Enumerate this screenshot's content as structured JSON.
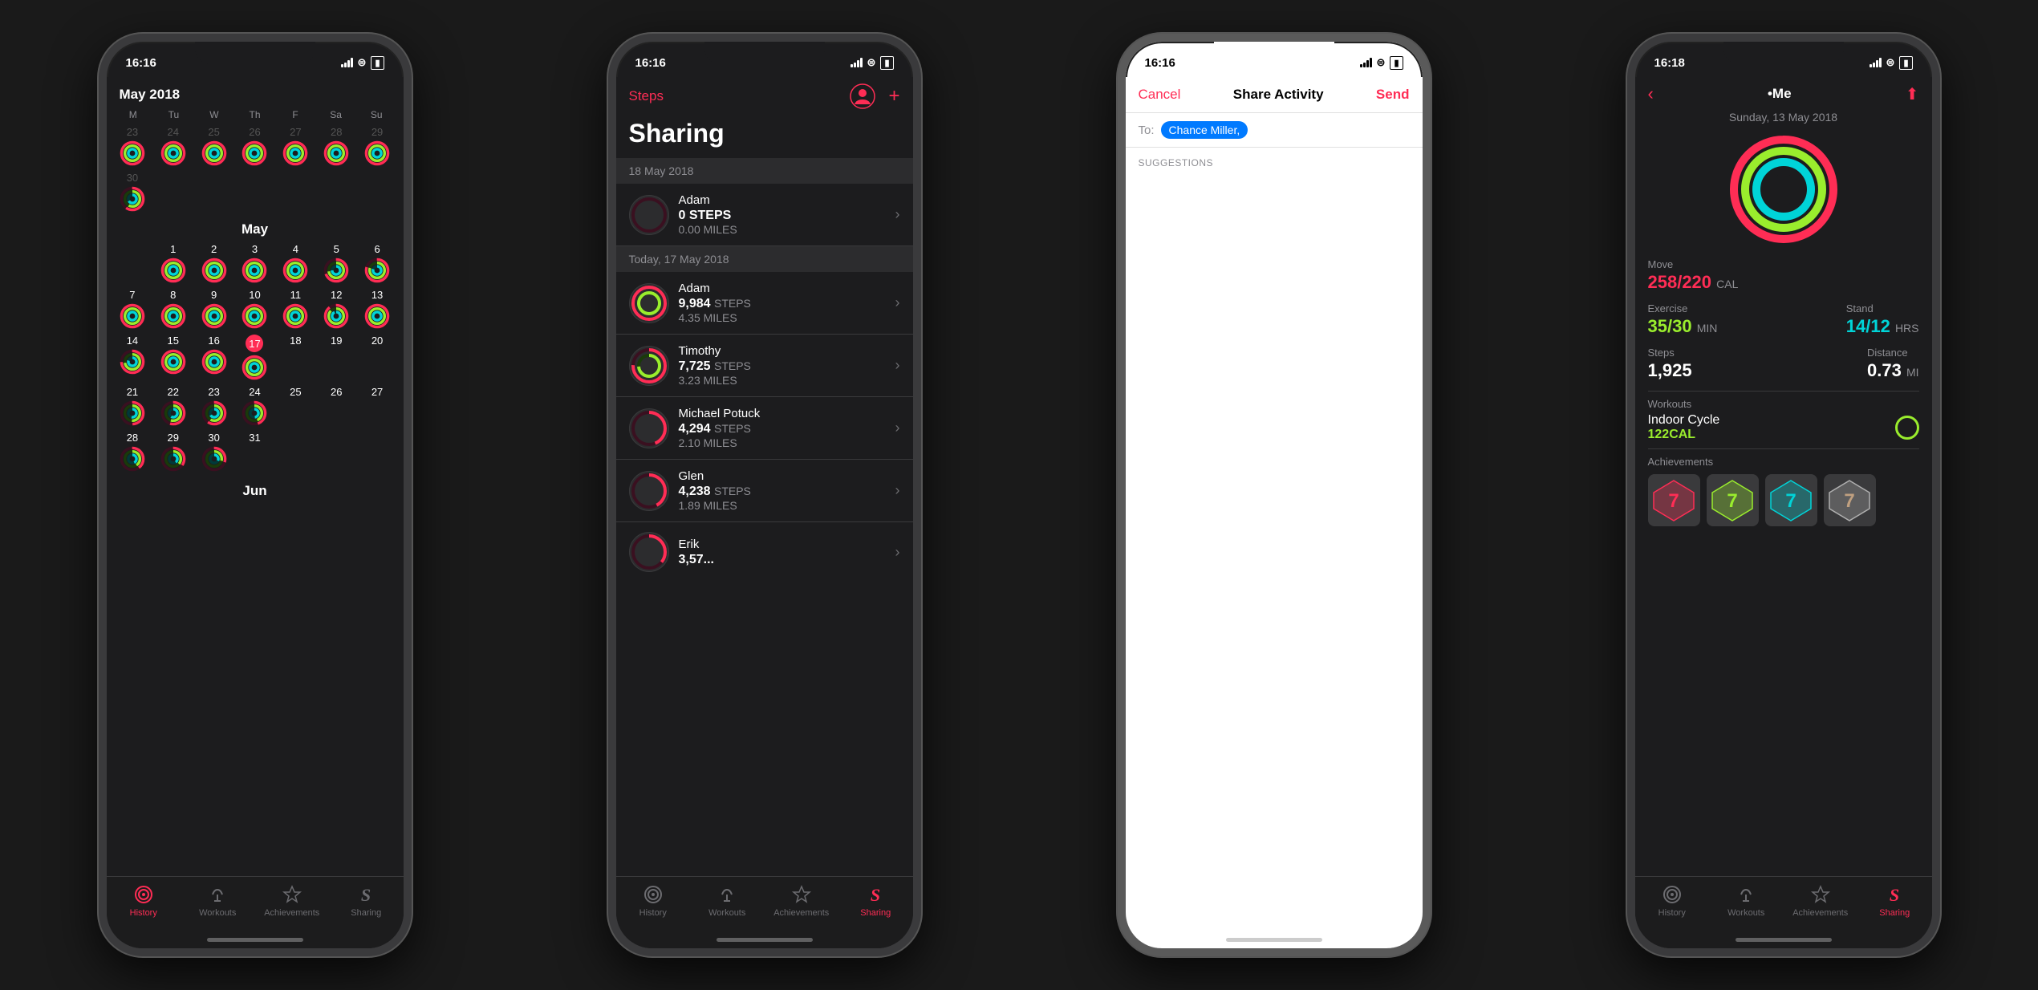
{
  "phones": [
    {
      "id": "phone1",
      "time": "16:16",
      "theme": "dark",
      "screen": "calendar",
      "calendar": {
        "months": [
          {
            "name": "May 2018",
            "showHeader": true,
            "weekdays": [
              "M",
              "Tu",
              "W",
              "Th",
              "F",
              "Sa",
              "Su"
            ],
            "rows": [
              [
                {
                  "day": "23",
                  "hasRing": true,
                  "ring": "full",
                  "prev": true
                },
                {
                  "day": "24",
                  "hasRing": true,
                  "ring": "full",
                  "prev": true
                },
                {
                  "day": "25",
                  "hasRing": true,
                  "ring": "full",
                  "prev": true
                },
                {
                  "day": "26",
                  "hasRing": true,
                  "ring": "full",
                  "prev": true
                },
                {
                  "day": "27",
                  "hasRing": true,
                  "ring": "full",
                  "prev": true
                },
                {
                  "day": "28",
                  "hasRing": true,
                  "ring": "full",
                  "prev": true
                },
                {
                  "day": "29",
                  "hasRing": true,
                  "ring": "full",
                  "prev": true
                }
              ],
              [
                {
                  "day": "30",
                  "hasRing": true,
                  "ring": "partial",
                  "prev": true
                },
                {
                  "day": "",
                  "hasRing": false
                },
                {
                  "day": "",
                  "hasRing": false
                },
                {
                  "day": "",
                  "hasRing": false
                },
                {
                  "day": "",
                  "hasRing": false
                },
                {
                  "day": "",
                  "hasRing": false
                },
                {
                  "day": "",
                  "hasRing": false
                }
              ]
            ]
          },
          {
            "name": "May",
            "showHeader": true,
            "rows": [
              [
                {
                  "day": "",
                  "hasRing": false
                },
                {
                  "day": "1",
                  "hasRing": true,
                  "ring": "full"
                },
                {
                  "day": "2",
                  "hasRing": true,
                  "ring": "full"
                },
                {
                  "day": "3",
                  "hasRing": true,
                  "ring": "full"
                },
                {
                  "day": "4",
                  "hasRing": true,
                  "ring": "full"
                },
                {
                  "day": "5",
                  "hasRing": true,
                  "ring": "partial"
                },
                {
                  "day": "6",
                  "hasRing": true,
                  "ring": "partial"
                }
              ],
              [
                {
                  "day": "7",
                  "hasRing": true,
                  "ring": "full"
                },
                {
                  "day": "8",
                  "hasRing": true,
                  "ring": "full"
                },
                {
                  "day": "9",
                  "hasRing": true,
                  "ring": "full"
                },
                {
                  "day": "10",
                  "hasRing": true,
                  "ring": "full"
                },
                {
                  "day": "11",
                  "hasRing": true,
                  "ring": "full"
                },
                {
                  "day": "12",
                  "hasRing": true,
                  "ring": "partial"
                },
                {
                  "day": "13",
                  "hasRing": true,
                  "ring": "full"
                }
              ],
              [
                {
                  "day": "14",
                  "hasRing": true,
                  "ring": "partial"
                },
                {
                  "day": "15",
                  "hasRing": true,
                  "ring": "full"
                },
                {
                  "day": "16",
                  "hasRing": true,
                  "ring": "full"
                },
                {
                  "day": "17",
                  "hasRing": true,
                  "ring": "full",
                  "today": true
                },
                {
                  "day": "18",
                  "hasRing": false
                },
                {
                  "day": "19",
                  "hasRing": false
                },
                {
                  "day": "20",
                  "hasRing": false
                }
              ],
              [
                {
                  "day": "21",
                  "hasRing": true,
                  "ring": "partial"
                },
                {
                  "day": "22",
                  "hasRing": true,
                  "ring": "partial"
                },
                {
                  "day": "23",
                  "hasRing": true,
                  "ring": "partial"
                },
                {
                  "day": "24",
                  "hasRing": true,
                  "ring": "partial"
                },
                {
                  "day": "25",
                  "hasRing": false
                },
                {
                  "day": "26",
                  "hasRing": false
                },
                {
                  "day": "27",
                  "hasRing": false
                }
              ],
              [
                {
                  "day": "28",
                  "hasRing": true,
                  "ring": "partial"
                },
                {
                  "day": "29",
                  "hasRing": true,
                  "ring": "partial"
                },
                {
                  "day": "30",
                  "hasRing": true,
                  "ring": "partial"
                },
                {
                  "day": "31",
                  "hasRing": false
                },
                {
                  "day": "",
                  "hasRing": false
                },
                {
                  "day": "",
                  "hasRing": false
                },
                {
                  "day": "",
                  "hasRing": false
                }
              ]
            ]
          },
          {
            "name": "Jun",
            "showHeader": true
          }
        ]
      },
      "tabs": [
        {
          "label": "History",
          "icon": "history",
          "active": true
        },
        {
          "label": "Workouts",
          "icon": "workouts",
          "active": false
        },
        {
          "label": "Achievements",
          "icon": "achievements",
          "active": false
        },
        {
          "label": "Sharing",
          "icon": "sharing",
          "active": false
        }
      ]
    },
    {
      "id": "phone2",
      "time": "16:16",
      "theme": "dark",
      "screen": "sharing",
      "sharing": {
        "nav_left": "Steps",
        "title": "Sharing",
        "section_date": "18 May 2018",
        "section_today": "Today, 17 May 2018",
        "items": [
          {
            "name": "Adam",
            "steps": "0 STEPS",
            "miles": "0.00 MILES",
            "date_section": "18 May 2018"
          },
          {
            "name": "Adam",
            "steps": "9,984 STEPS",
            "miles": "4.35 MILES",
            "date_section": "today"
          },
          {
            "name": "Timothy",
            "steps": "7,725 STEPS",
            "miles": "3.23 MILES",
            "date_section": "today"
          },
          {
            "name": "Michael Potuck",
            "steps": "4,294 STEPS",
            "miles": "2.10 MILES",
            "date_section": "today"
          },
          {
            "name": "Glen",
            "steps": "4,238 STEPS",
            "miles": "1.89 MILES",
            "date_section": "today"
          },
          {
            "name": "Erik",
            "steps": "3,57...",
            "miles": "",
            "date_section": "today"
          }
        ]
      },
      "tabs": [
        {
          "label": "History",
          "icon": "history",
          "active": false
        },
        {
          "label": "Workouts",
          "icon": "workouts",
          "active": false
        },
        {
          "label": "Achievements",
          "icon": "achievements",
          "active": false
        },
        {
          "label": "Sharing",
          "icon": "sharing",
          "active": true
        }
      ]
    },
    {
      "id": "phone3",
      "time": "16:16",
      "theme": "light",
      "screen": "share_activity",
      "share_activity": {
        "cancel": "Cancel",
        "title": "Share Activity",
        "send": "Send",
        "to_label": "To:",
        "to_recipient": "Chance Miller,",
        "suggestions_label": "SUGGESTIONS"
      }
    },
    {
      "id": "phone4",
      "time": "16:18",
      "theme": "dark",
      "screen": "me_detail",
      "me_detail": {
        "title": "•Me",
        "date": "Sunday, 13 May 2018",
        "move_label": "Move",
        "move_value": "258/220",
        "move_unit": "CAL",
        "exercise_label": "Exercise",
        "exercise_value": "35/30",
        "exercise_unit": "MIN",
        "stand_label": "Stand",
        "stand_value": "14/12",
        "stand_unit": "HRS",
        "steps_label": "Steps",
        "steps_value": "1,925",
        "distance_label": "Distance",
        "distance_value": "0.73",
        "distance_unit": "MI",
        "workouts_label": "Workouts",
        "workout_name": "Indoor Cycle",
        "workout_cal": "122CAL",
        "achievements_label": "Achievements"
      },
      "tabs": [
        {
          "label": "History",
          "icon": "history",
          "active": false
        },
        {
          "label": "Workouts",
          "icon": "workouts",
          "active": false
        },
        {
          "label": "Achievements",
          "icon": "achievements",
          "active": false
        },
        {
          "label": "Sharing",
          "icon": "sharing",
          "active": true
        }
      ]
    }
  ],
  "colors": {
    "move": "#ff2d55",
    "exercise": "#9aed2d",
    "stand": "#00d4d8",
    "accent": "#ff2d55",
    "dark_bg": "#1c1c1e",
    "tab_inactive": "#6c6c70"
  }
}
